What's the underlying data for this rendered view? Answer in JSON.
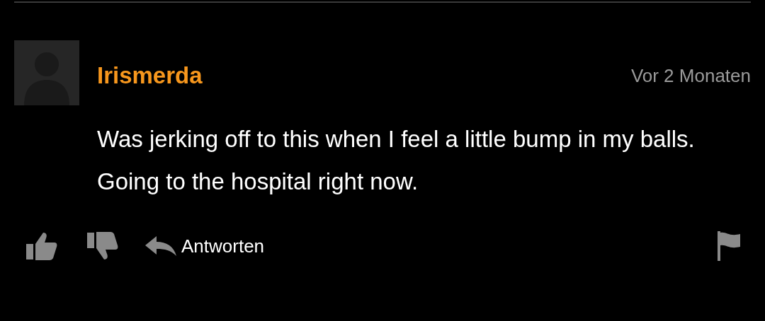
{
  "comment": {
    "author": "Irismerda",
    "time": "Vor 2 Monaten",
    "text": "Was jerking off to this when I feel a little bump in my balls. Going to the hospital right now.",
    "reply_label": "Antworten"
  }
}
